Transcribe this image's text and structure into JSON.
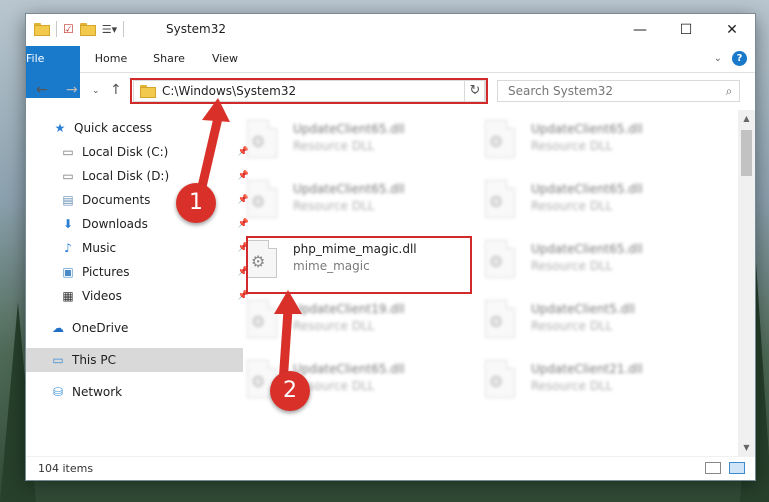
{
  "window": {
    "title": "System32",
    "controls": {
      "minimize": "—",
      "maximize": "☐",
      "close": "✕"
    }
  },
  "ribbon": {
    "tabs": [
      "File",
      "Home",
      "Share",
      "View"
    ]
  },
  "nav": {
    "address": "C:\\Windows\\System32",
    "search_placeholder": "Search System32"
  },
  "sidebar": {
    "items": [
      {
        "label": "Quick access",
        "icon": "star-icon"
      },
      {
        "label": "Local Disk (C:)",
        "icon": "drive-icon"
      },
      {
        "label": "Local Disk (D:)",
        "icon": "drive-icon"
      },
      {
        "label": "Documents",
        "icon": "documents-icon"
      },
      {
        "label": "Downloads",
        "icon": "download-icon"
      },
      {
        "label": "Music",
        "icon": "music-icon"
      },
      {
        "label": "Pictures",
        "icon": "pictures-icon"
      },
      {
        "label": "Videos",
        "icon": "videos-icon"
      },
      {
        "label": "OneDrive",
        "icon": "cloud-icon"
      },
      {
        "label": "This PC",
        "icon": "computer-icon"
      },
      {
        "label": "Network",
        "icon": "network-icon"
      }
    ]
  },
  "files": [
    {
      "name": "UpdateClient65.dll",
      "desc": "Resource DLL"
    },
    {
      "name": "UpdateClient65.dll",
      "desc": "Resource DLL"
    },
    {
      "name": "UpdateClient65.dll",
      "desc": "Resource DLL"
    },
    {
      "name": "UpdateClient65.dll",
      "desc": "Resource DLL"
    },
    {
      "name": "php_mime_magic.dll",
      "desc": "mime_magic"
    },
    {
      "name": "UpdateClient65.dll",
      "desc": "Resource DLL"
    },
    {
      "name": "UpdateClient19.dll",
      "desc": "Resource DLL"
    },
    {
      "name": "UpdateClient5.dll",
      "desc": "Resource DLL"
    },
    {
      "name": "UpdateClient65.dll",
      "desc": "Resource DLL"
    },
    {
      "name": "UpdateClient21.dll",
      "desc": "Resource DLL"
    }
  ],
  "status": {
    "count": "104 items"
  },
  "callouts": [
    "1",
    "2"
  ],
  "colors": {
    "accent": "#1979ca",
    "highlight": "#d02a2a",
    "callout": "#d9312a"
  }
}
